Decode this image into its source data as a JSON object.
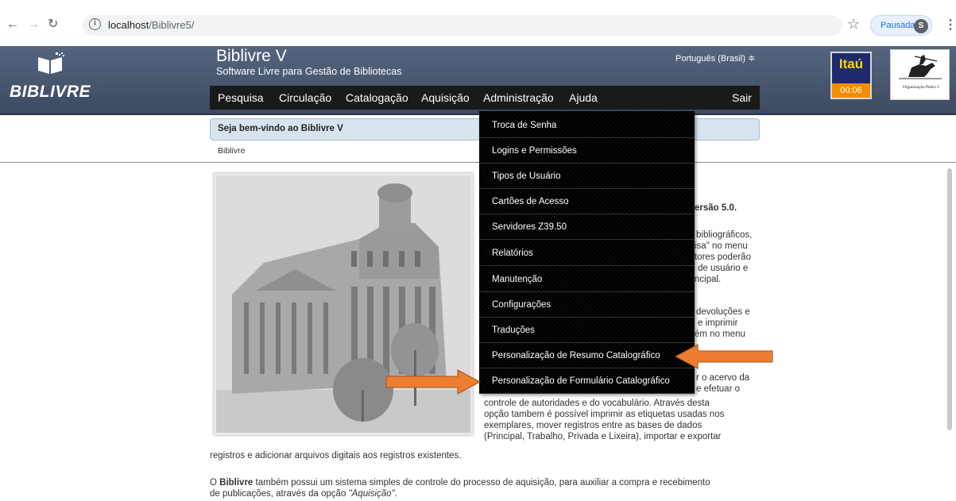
{
  "browser": {
    "url_host": "localhost",
    "url_path": "/Biblivre5/",
    "profile_label": "Pausada",
    "profile_initial": "S"
  },
  "header": {
    "logo_text": "BIBLIVRE",
    "title": "Biblivre V",
    "subtitle": "Software Livre para Gestão de Bibliotecas",
    "language": "Português (Brasil) ≑",
    "sponsor_brand": "Itaú",
    "timer": "00:06",
    "org_text": "Organização Pedro I"
  },
  "menu": {
    "items": [
      "Pesquisa",
      "Circulação",
      "Catalogação",
      "Aquisição",
      "Administração",
      "Ajuda"
    ],
    "logout": "Sair"
  },
  "admin_menu": {
    "items": [
      "Troca de Senha",
      "Logins e Permissões",
      "Tipos de Usuário",
      "Cartões de Acesso",
      "Servidores Z39.50",
      "Relatórios",
      "Manutenção",
      "Configurações",
      "Traduções",
      "Personalização de Resumo Catalográfico",
      "Personalização de Formulário Catalográfico"
    ]
  },
  "welcome": {
    "title": "Seja bem-vindo ao Biblivre V",
    "breadcrumb": "Biblivre"
  },
  "body_text": {
    "version": "ersão 5.0.",
    "p1": [
      "bibliográficos,",
      "isa\" no menu",
      "tores poderão",
      "de usuário e",
      "ncipal."
    ],
    "p2": [
      "devoluções e",
      "e   imprimir",
      "ém no menu"
    ],
    "p3_right": [
      "r o acervo da",
      "e   efetuar o"
    ],
    "p3_full": [
      "controle de autoridades e do vocabulário. Através desta",
      "opção tambem é possível imprimir as etiquetas usadas nos",
      "exemplares, mover registros entre as bases de dados",
      "(Principal, Trabalho, Privada e Lixeira), importar e exportar"
    ],
    "p3_last": "registros e adicionar arquivos digitais aos registros existentes.",
    "p4_prefix": "O ",
    "p4_bold": "Biblivre",
    "p4_line1": " também possui um sistema simples de controle do processo de aquisição, para auxiliar a compra e recebimento",
    "p4_line2_prefix": "de publicações, através da opção ",
    "p4_line2_em": "\"Aquisição\"",
    "p4_line2_suffix": "."
  },
  "colors": {
    "header": "#4a586f",
    "menu_bar": "#1a1a1a",
    "arrow": "#ed7d31",
    "welcome_bar": "#d8e3f0"
  }
}
